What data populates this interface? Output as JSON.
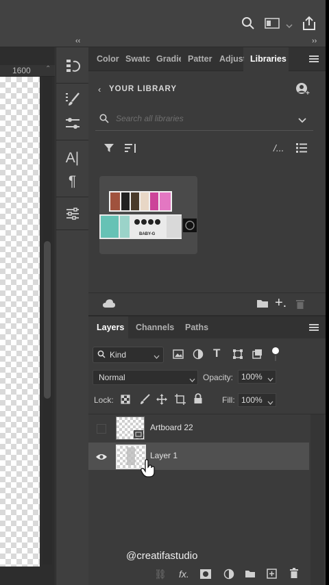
{
  "ruler": {
    "value": "1600"
  },
  "tabs": [
    "Color",
    "Swatches",
    "Gradients",
    "Patterns",
    "Adjustments",
    "Libraries"
  ],
  "tabs_display": [
    "Color",
    "Swatcl",
    "Gradie",
    "Patter",
    "Adjust",
    "Libraries"
  ],
  "library": {
    "header": "YOUR LIBRARY",
    "search_placeholder": "Search all libraries",
    "thumb_label": "BABY-G"
  },
  "layers_panel": {
    "tabs": [
      "Layers",
      "Channels",
      "Paths"
    ],
    "kind_label": "Kind",
    "blend_mode": "Normal",
    "opacity_label": "Opacity:",
    "opacity_value": "100%",
    "lock_label": "Lock:",
    "fill_label": "Fill:",
    "fill_value": "100%",
    "layers": [
      {
        "name": "Artboard 22",
        "visible": false,
        "selected": false
      },
      {
        "name": "Layer 1",
        "visible": true,
        "selected": true
      }
    ]
  },
  "watermark": "@creatifastudio",
  "colors": {
    "panel_bg": "#3b3b3b",
    "tab_bar_bg": "#323232",
    "selected_row": "#505050",
    "text_active": "#ffffff",
    "text_inactive": "#b0b0b0"
  }
}
